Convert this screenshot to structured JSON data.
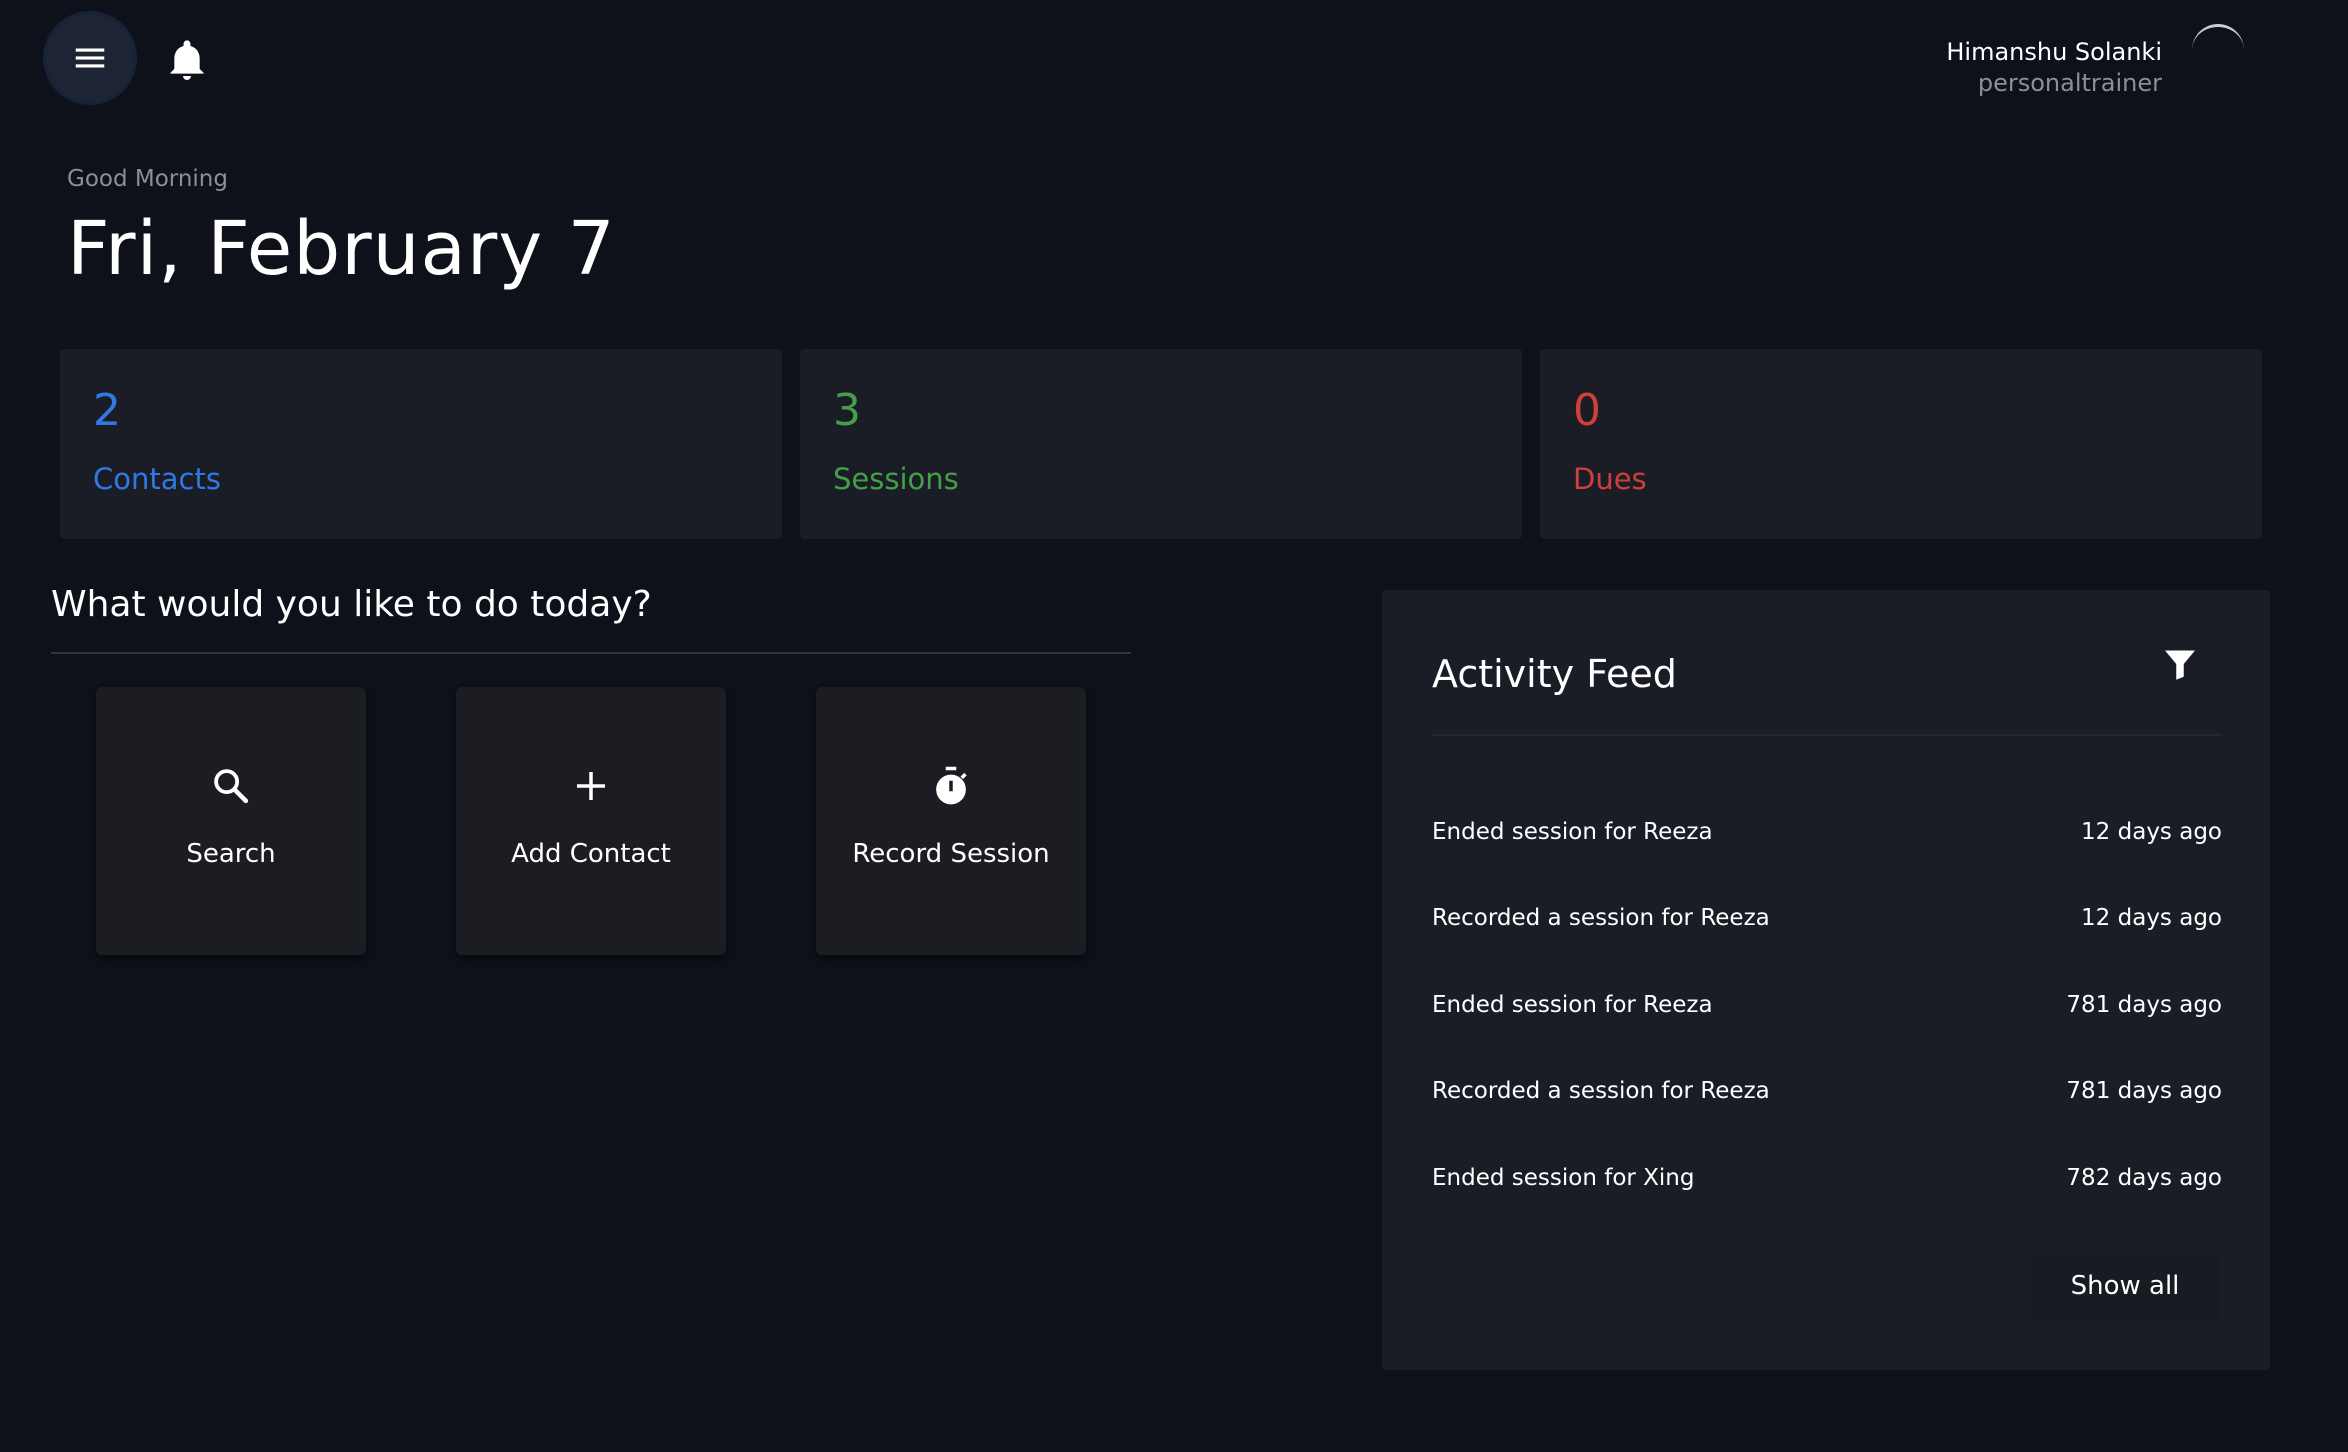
{
  "header": {
    "menu_icon": "hamburger-menu-icon",
    "notification_icon": "bell-icon",
    "user": {
      "name": "Himanshu Solanki",
      "role": "personaltrainer"
    }
  },
  "greeting": {
    "salutation": "Good Morning",
    "date": "Fri, February 7"
  },
  "stats": [
    {
      "value": "2",
      "label": "Contacts",
      "color": "#2f78e6"
    },
    {
      "value": "3",
      "label": "Sessions",
      "color": "#43a047"
    },
    {
      "value": "0",
      "label": "Dues",
      "color": "#d13f3a"
    }
  ],
  "quick_actions": {
    "title": "What would you like to do today?",
    "items": [
      {
        "label": "Search",
        "icon": "search-icon"
      },
      {
        "label": "Add Contact",
        "icon": "plus-icon"
      },
      {
        "label": "Record Session",
        "icon": "stopwatch-icon"
      }
    ]
  },
  "activity_feed": {
    "title": "Activity Feed",
    "filter_icon": "filter-icon",
    "items": [
      {
        "text": "Ended session for Reeza",
        "time": "12 days ago"
      },
      {
        "text": "Recorded a session for Reeza",
        "time": "12 days ago"
      },
      {
        "text": "Ended session for Reeza",
        "time": "781 days ago"
      },
      {
        "text": "Recorded a session for Reeza",
        "time": "781 days ago"
      },
      {
        "text": "Ended session for Xing",
        "time": "782 days ago"
      }
    ],
    "show_all_label": "Show all"
  }
}
